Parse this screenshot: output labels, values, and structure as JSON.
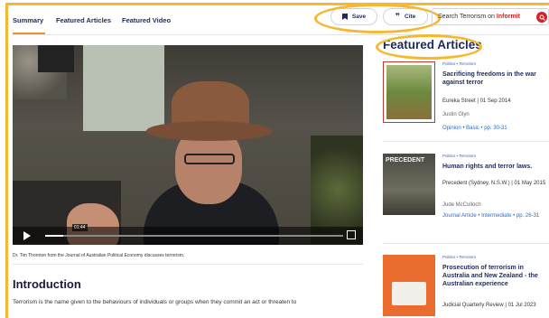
{
  "tabs": [
    {
      "label": "Summary",
      "active": true
    },
    {
      "label": "Featured Articles"
    },
    {
      "label": "Featured Video"
    }
  ],
  "actions": {
    "save_label": "Save",
    "cite_label": "Cite"
  },
  "search": {
    "prefix": "Search Terrorism on",
    "brand": "Informit"
  },
  "video": {
    "time": "01:44",
    "progress": 0.06
  },
  "caption": "Dr. Tim Thornton from the Journal of Australian Political Economy discusses terrorism.",
  "intro": {
    "heading": "Introduction",
    "text": "Terrorism is the name given to the behaviours of individuals or groups when they commit an act or threaten to"
  },
  "featured": {
    "heading": "Featured Articles",
    "articles": [
      {
        "meta": "Politics • Terrorism",
        "title": "Sacrificing freedoms in the war against terror",
        "source": "Eureka Street | 01 Sep 2014",
        "author": "Justin Glyn",
        "type": "Opinion • Basic • pp. 30-31"
      },
      {
        "meta": "Politics • Terrorism",
        "title": "Human rights and terror laws.",
        "source": "Precedent (Sydney, N.S.W.) | 01 May 2015",
        "author": "Jude McCulloch",
        "type": "Journal Article • Intermediate • pp. 26-31"
      },
      {
        "meta": "Politics • Terrorism",
        "title": "Prosecution of terrorism in Australia and New Zealand - the Australian experience",
        "source": "Judicial Quarterly Review | 01 Jul 2023"
      }
    ],
    "thumb_labels": [
      "PRECEDENT"
    ]
  },
  "colors": {
    "accent": "#f5b82e",
    "navy": "#1e2a5a",
    "brand_red": "#d2232a",
    "link": "#2b6bc4"
  }
}
